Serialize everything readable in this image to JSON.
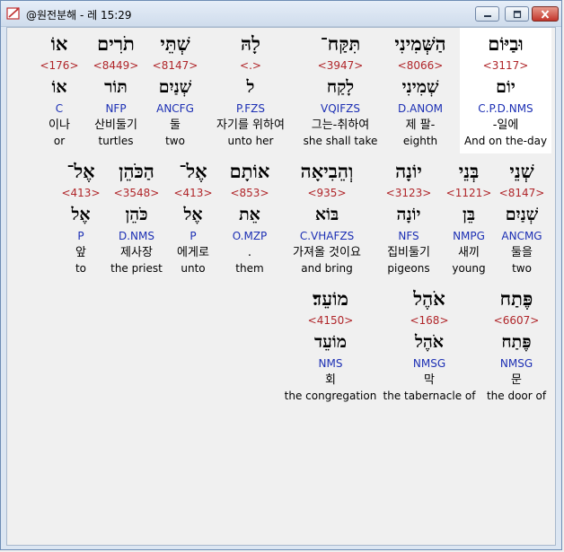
{
  "window": {
    "title": "@원전분해 - 레 15:29"
  },
  "words": [
    {
      "hebrew": "וּבַיּוֹם",
      "strong": "<3117>",
      "lemma": "יוֹם",
      "parse": "C.P.D.NMS",
      "korean": "-일에",
      "english": "And on the-day",
      "selected": true
    },
    {
      "hebrew": "הַשְּׁמִינִי",
      "strong": "<8066>",
      "lemma": "שְׁמִינִי",
      "parse": "D.ANOM",
      "korean": "제 팔-",
      "english": "eighth",
      "selected": false
    },
    {
      "hebrew": "תִּקַּח־",
      "strong": "<3947>",
      "lemma": "לָקַח",
      "parse": "VQIFZS",
      "korean": "그는-취하여",
      "english": "she shall take",
      "selected": false
    },
    {
      "hebrew": "לָהּ",
      "strong": "<.>",
      "lemma": "ל",
      "parse": "P.FZS",
      "korean": "자기를 위하여",
      "english": "unto her",
      "selected": false
    },
    {
      "hebrew": "שְׁתֵּי",
      "strong": "<8147>",
      "lemma": "שְׁנַיִם",
      "parse": "ANCFG",
      "korean": "둘",
      "english": "two",
      "selected": false
    },
    {
      "hebrew": "תֹרִים",
      "strong": "<8449>",
      "lemma": "תּוֹר",
      "parse": "NFP",
      "korean": "산비둘기",
      "english": "turtles",
      "selected": false
    },
    {
      "hebrew": "אוֹ",
      "strong": "<176>",
      "lemma": "אוֹ",
      "parse": "C",
      "korean": "이나",
      "english": "or",
      "selected": false
    },
    {
      "hebrew": "שְׁנֵי",
      "strong": "<8147>",
      "lemma": "שְׁנַיִם",
      "parse": "ANCMG",
      "korean": "둘을",
      "english": "two",
      "selected": false
    },
    {
      "hebrew": "בְּנֵי",
      "strong": "<1121>",
      "lemma": "בֵּן",
      "parse": "NMPG",
      "korean": "새끼",
      "english": "young",
      "selected": false
    },
    {
      "hebrew": "יוֹנָה",
      "strong": "<3123>",
      "lemma": "יוֹנָה",
      "parse": "NFS",
      "korean": "집비둘기",
      "english": "pigeons",
      "selected": false
    },
    {
      "hebrew": "וְהֵבִיאָה",
      "strong": "<935>",
      "lemma": "בּוֹא",
      "parse": "C.VHAFZS",
      "korean": "가져올 것이요",
      "english": "and bring",
      "selected": false
    },
    {
      "hebrew": "אוֹתָם",
      "strong": "<853>",
      "lemma": "אֵת",
      "parse": "O.MZP",
      "korean": ".",
      "english": "them",
      "selected": false
    },
    {
      "hebrew": "אֶל־",
      "strong": "<413>",
      "lemma": "אֶל",
      "parse": "P",
      "korean": "에게로",
      "english": "unto",
      "selected": false
    },
    {
      "hebrew": "הַכֹּהֵן",
      "strong": "<3548>",
      "lemma": "כֹּהֵן",
      "parse": "D.NMS",
      "korean": "제사장",
      "english": "the priest",
      "selected": false
    },
    {
      "hebrew": "אֶל־",
      "strong": "<413>",
      "lemma": "אֶל",
      "parse": "P",
      "korean": "앞",
      "english": "to",
      "selected": false
    },
    {
      "hebrew": "פֶּתַח",
      "strong": "<6607>",
      "lemma": "פֶּתַח",
      "parse": "NMSG",
      "korean": "문",
      "english": "the door of",
      "selected": false
    },
    {
      "hebrew": "אֹהֶל",
      "strong": "<168>",
      "lemma": "אֹהֶל",
      "parse": "NMSG",
      "korean": "막",
      "english": "the tabernacle of",
      "selected": false
    },
    {
      "hebrew": "מוֹעֵד׃",
      "strong": "<4150>",
      "lemma": "מוֹעֵד",
      "parse": "NMS",
      "korean": "회",
      "english": "the congregation",
      "selected": false
    }
  ],
  "colors": {
    "strong": "#b0262a",
    "parse": "#1c2fb4",
    "selected_bg": "#ffffff"
  }
}
